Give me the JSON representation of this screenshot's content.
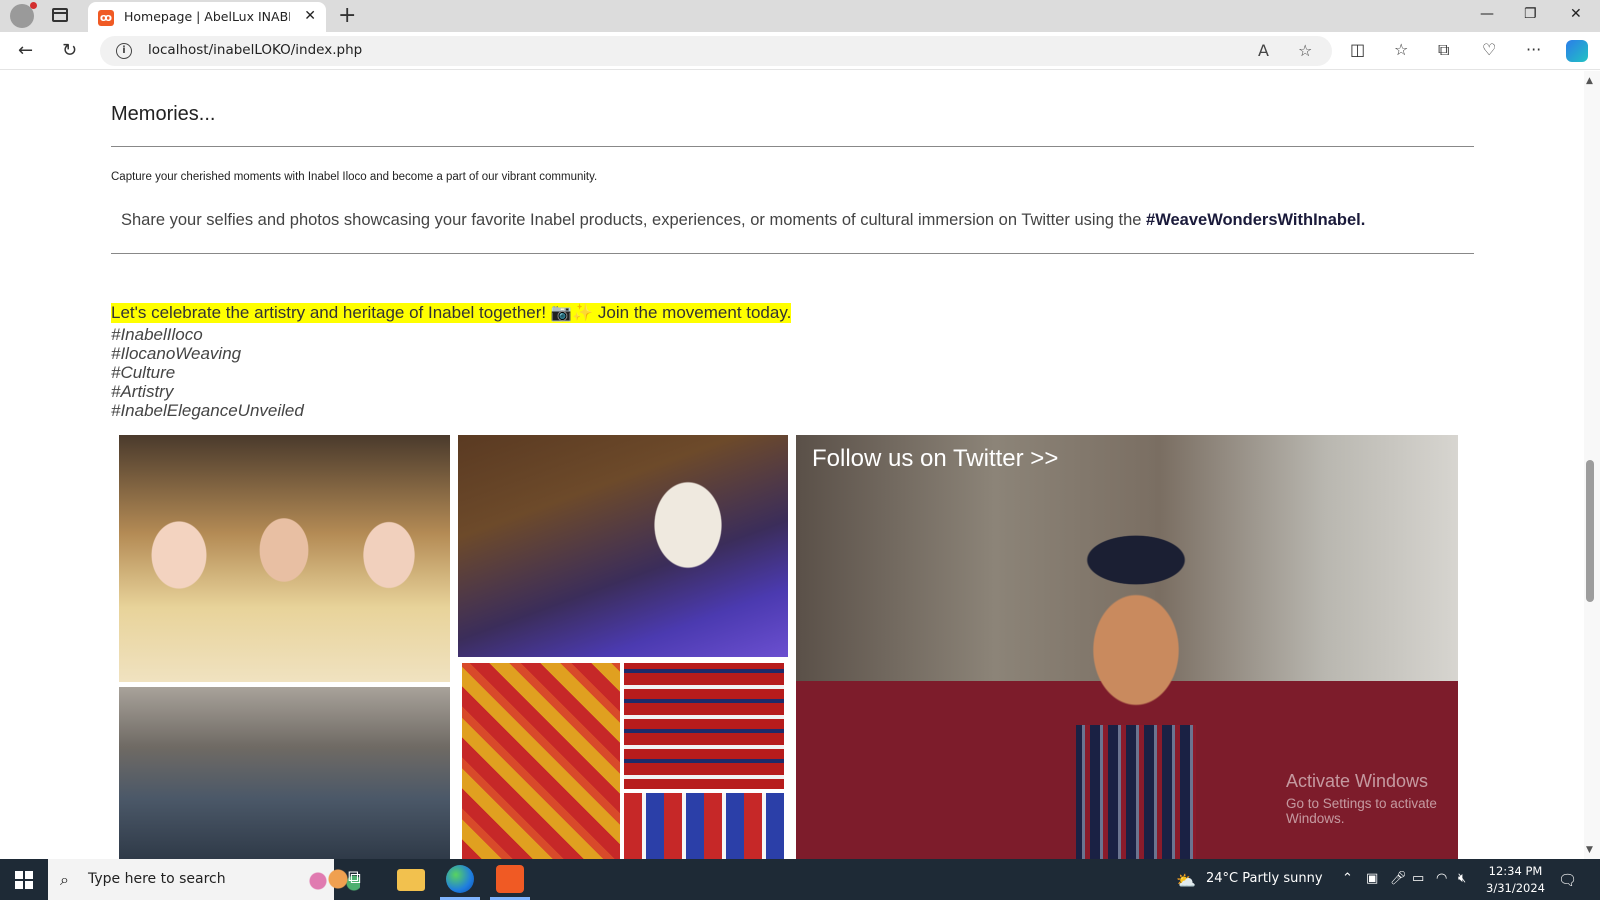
{
  "browser": {
    "tab_title": "Homepage | AbelLux INABEL ILOKO",
    "tab_favicon": "xampp-icon",
    "url": "localhost/inabelLOKO/index.php",
    "window_controls": {
      "minimize": "—",
      "restore": "❐",
      "close": "✕"
    }
  },
  "section": {
    "title": "Memories...",
    "intro": "Capture your cherished moments with Inabel Iloco and become a part of our vibrant community.",
    "share_text": "Share your selfies and photos showcasing your favorite Inabel products, experiences, or moments of cultural immersion on Twitter using the ",
    "share_hashtag": "#WeaveWondersWithInabel.",
    "highlight": "Let's celebrate the artistry and heritage of Inabel together! 📷✨ Join the movement today.",
    "tags": [
      "#InabelIloco",
      "#IlocanoWeaving",
      "#Culture",
      "#Artistry",
      "#InabelEleganceUnveiled"
    ],
    "follow_link": "Follow us on Twitter >>"
  },
  "watermark": {
    "line1": "Activate Windows",
    "line2": "Go to Settings to activate Windows."
  },
  "taskbar": {
    "search_placeholder": "Type here to search",
    "weather": "24°C  Partly sunny",
    "time": "12:34 PM",
    "date": "3/31/2024"
  }
}
